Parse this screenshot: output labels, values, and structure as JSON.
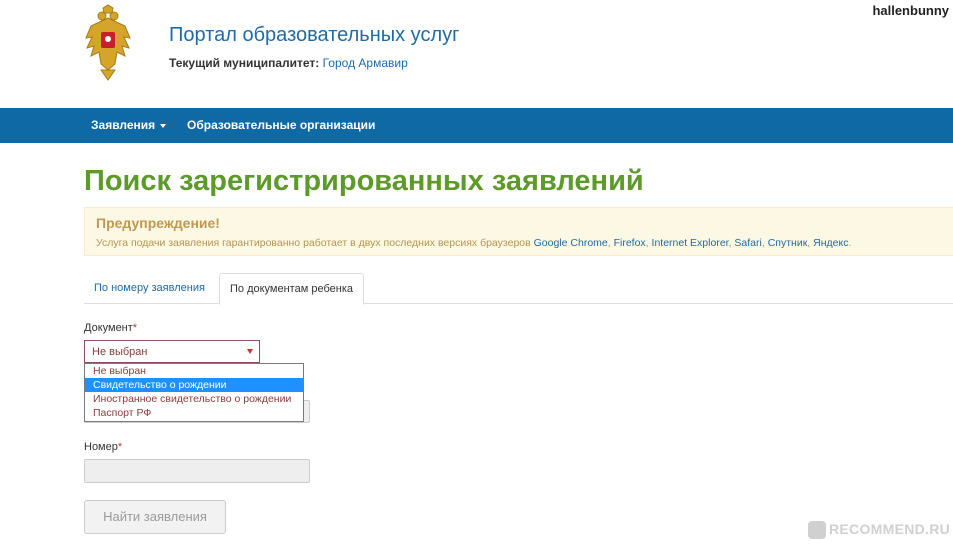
{
  "header": {
    "portal_title": "Портал образовательных услуг",
    "municipality_label": "Текущий муниципалитет:",
    "municipality_value": "Город Армавир",
    "user_name": "hallenbunny"
  },
  "navbar": {
    "applications": "Заявления",
    "organizations": "Образовательные организации"
  },
  "page": {
    "title": "Поиск зарегистрированных заявлений"
  },
  "warning": {
    "title": "Предупреждение!",
    "text": "Услуга подачи заявления гарантированно работает в двух последних версиях браузеров",
    "browsers": [
      "Google Chrome",
      "Firefox",
      "Internet Explorer",
      "Safari",
      "Спутник",
      "Яндекс"
    ]
  },
  "tabs": {
    "by_number": "По номеру заявления",
    "by_documents": "По документам ребенка"
  },
  "form": {
    "document_label": "Документ",
    "required_mark": "*",
    "document_value": "Не выбран",
    "document_options": [
      "Не выбран",
      "Свидетельство о рождении",
      "Иностранное свидетельство о рождении",
      "Паспорт РФ"
    ],
    "number_label": "Номер",
    "search_button": "Найти заявления"
  },
  "watermark": {
    "text": "RECOMMEND.RU"
  },
  "colors": {
    "navbar": "#0f69a4",
    "title_green": "#5c9a29",
    "link_blue": "#1f6aa8",
    "warning_bg": "#fcf8e3"
  }
}
